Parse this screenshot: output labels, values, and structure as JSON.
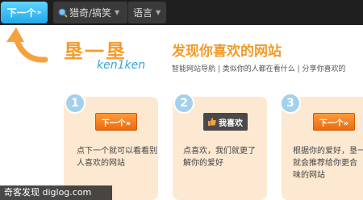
{
  "toolbar": {
    "next_label": "下一个",
    "next_arrow": "»",
    "category_label": "猎奇/搞笑",
    "language_label": "语言"
  },
  "brand": {
    "logo_cn": "垦一垦",
    "logo_en": "ken1ken",
    "slogan": "发现你喜欢的网站",
    "subline": "智能网站导航 | 类似你的人都在看什么 | 分享你喜欢的"
  },
  "steps": [
    {
      "number": "1",
      "button": "下一个»",
      "text": "点下一个就可以看看别人喜欢的网站"
    },
    {
      "number": "2",
      "button": "我喜欢",
      "text": "点喜欢，我们就更了解你的爱好"
    },
    {
      "number": "3",
      "button": "下一个»",
      "text_lines": [
        "根据你的爱好，垦一",
        "就会推荐给你更合",
        "味的网站"
      ]
    }
  ],
  "watermark": "奇客发现 diglog.com",
  "colors": {
    "accent_orange": "#f39b29",
    "accent_blue": "#37a3d6",
    "card_bg": "#fde9d2",
    "topbar_bg": "#1f1f1f"
  }
}
